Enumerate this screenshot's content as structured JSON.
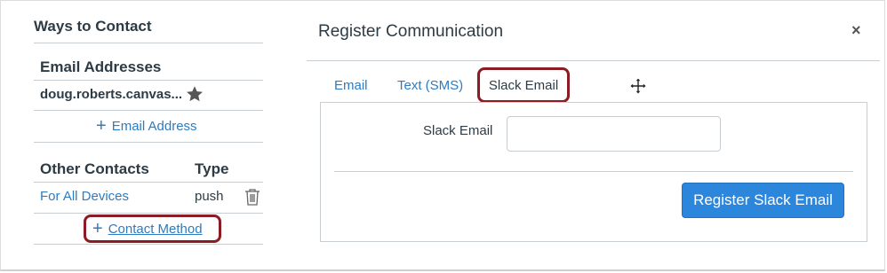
{
  "left_panel": {
    "title": "Ways to Contact",
    "email_section": {
      "title": "Email Addresses",
      "email": "doug.roberts.canvas...",
      "add_label": "Email Address"
    },
    "other_section": {
      "title": "Other Contacts",
      "type_header": "Type",
      "rows": [
        {
          "name": "For All Devices",
          "type": "push"
        }
      ],
      "add_label": "Contact Method"
    }
  },
  "dialog": {
    "title": "Register Communication",
    "close_label": "×",
    "tabs": [
      {
        "label": "Email"
      },
      {
        "label": "Text (SMS)"
      },
      {
        "label": "Slack Email"
      }
    ],
    "field_label": "Slack Email",
    "field_value": "",
    "field_placeholder": "",
    "submit_label": "Register Slack Email"
  },
  "colors": {
    "link": "#2d7bc0",
    "button": "#2b86dc",
    "highlight": "#8b1c24",
    "text": "#2d3b45"
  }
}
